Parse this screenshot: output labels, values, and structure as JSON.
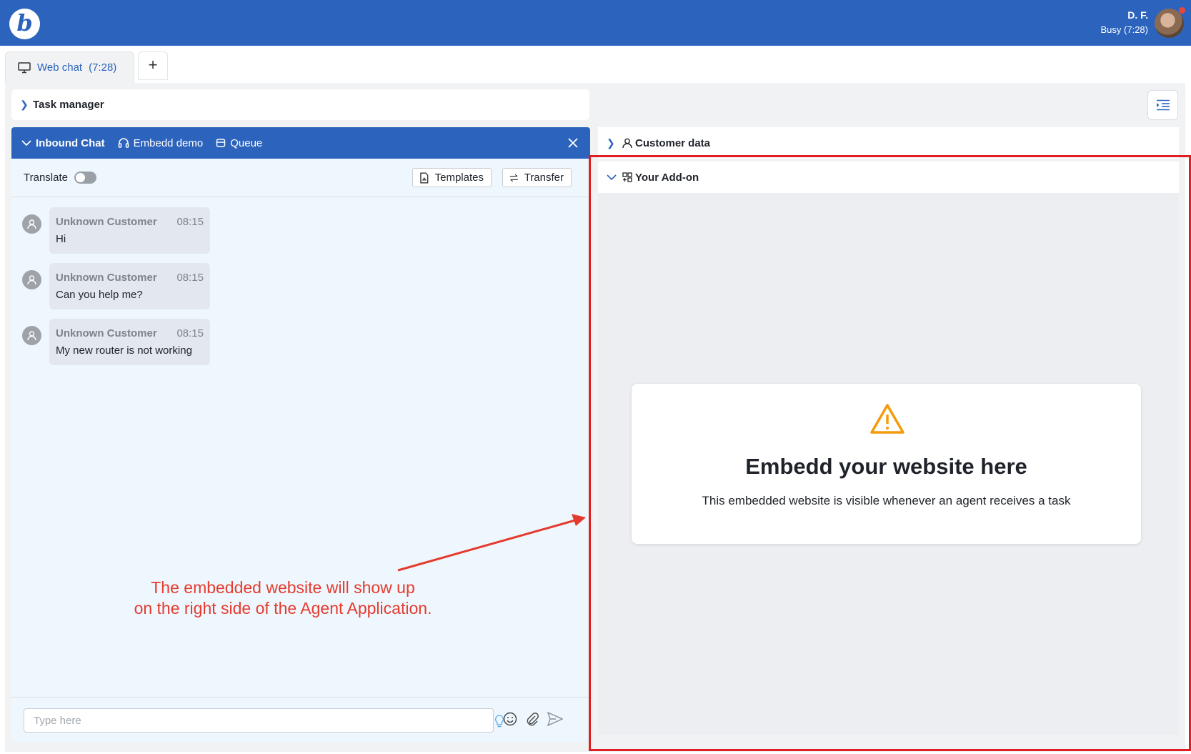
{
  "topbar": {
    "logo_letter": "b",
    "user_name": "D. F.",
    "user_status": "Busy (7:28)"
  },
  "tabs": {
    "active_label": "Web chat",
    "active_timer": "(7:28)",
    "add_label": "+"
  },
  "task_manager": {
    "label": "Task manager"
  },
  "chat": {
    "header": {
      "inbound_label": "Inbound Chat",
      "embedd_label": "Embedd demo",
      "queue_label": "Queue"
    },
    "toolbar": {
      "translate_label": "Translate",
      "templates_label": "Templates",
      "transfer_label": "Transfer"
    },
    "messages": [
      {
        "sender": "Unknown Customer",
        "time": "08:15",
        "text": "Hi"
      },
      {
        "sender": "Unknown Customer",
        "time": "08:15",
        "text": "Can you help me?"
      },
      {
        "sender": "Unknown Customer",
        "time": "08:15",
        "text": "My new router is not working"
      }
    ],
    "composer": {
      "placeholder": "Type here"
    }
  },
  "annotation": {
    "line1": "The embedded website will show up",
    "line2": "on the right side of the Agent Application."
  },
  "right_panel": {
    "customer_data_label": "Customer data",
    "addon_label": "Your Add-on",
    "card_title": "Embedd your website here",
    "card_text": "This embedded website is visible whenever an agent receives a task"
  },
  "colors": {
    "brand": "#2c63bd",
    "annotation": "#e53b2f",
    "warning": "#f59a0b"
  }
}
